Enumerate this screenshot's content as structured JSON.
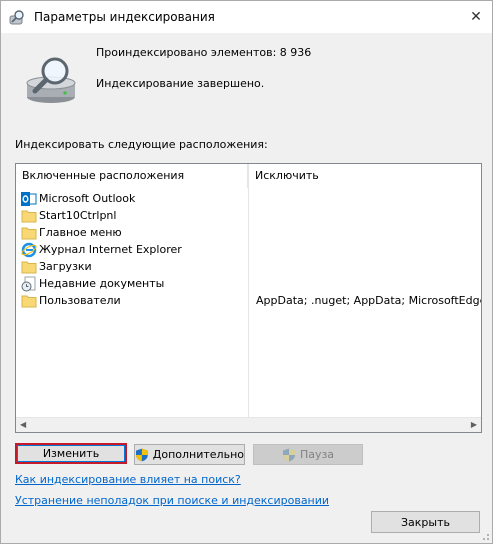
{
  "window": {
    "title": "Параметры индексирования",
    "close_glyph": "✕"
  },
  "stats": {
    "indexed_count": "Проиндексировано элементов: 8 936",
    "status": "Индексирование завершено."
  },
  "locations_label": "Индексировать следующие расположения:",
  "list": {
    "col_included": "Включенные расположения",
    "col_excluded": "Исключить",
    "rows": [
      {
        "name": "Microsoft Outlook",
        "exclude": "",
        "icon": "outlook-icon"
      },
      {
        "name": "Start10Ctrlpnl",
        "exclude": "",
        "icon": "folder-icon"
      },
      {
        "name": "Главное меню",
        "exclude": "",
        "icon": "folder-icon"
      },
      {
        "name": "Журнал Internet Explorer",
        "exclude": "",
        "icon": "internet-explorer-icon"
      },
      {
        "name": "Загрузки",
        "exclude": "",
        "icon": "folder-icon"
      },
      {
        "name": "Недавние документы",
        "exclude": "",
        "icon": "recent-documents-icon"
      },
      {
        "name": "Пользователи",
        "exclude": "AppData; .nuget; AppData; MicrosoftEdgeBack",
        "icon": "folder-icon"
      }
    ]
  },
  "buttons": {
    "modify": "Изменить",
    "advanced": "Дополнительно",
    "pause": "Пауза",
    "close": "Закрыть"
  },
  "links": {
    "how_indexing_affects": "Как индексирование влияет на поиск?",
    "troubleshoot": "Устранение неполадок при поиске и индексировании"
  },
  "colors": {
    "link": "#0066cc",
    "focus_border": "#c41a2a",
    "folder": "#f8d775"
  }
}
